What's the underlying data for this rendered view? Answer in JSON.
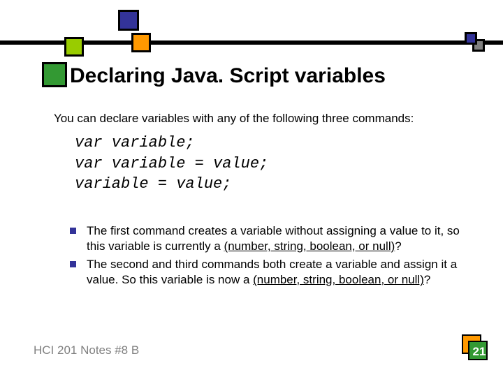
{
  "title": "Declaring Java. Script variables",
  "intro": "You can declare variables with any of the following three commands:",
  "code": {
    "line1": "var variable;",
    "line2": "var variable = value;",
    "line3": "variable = value;"
  },
  "bullets": [
    {
      "pre": "The first command creates a variable without assigning a value to it, so this variable is currently a ",
      "underline": "(number, string, boolean, or null)",
      "post": "?"
    },
    {
      "pre": "The second and third commands both create a variable and assign it a value. So this variable is now a ",
      "underline": "(number, string, boolean, or null)",
      "post": "?"
    }
  ],
  "footer": "HCI 201 Notes #8 B",
  "page_number": "21"
}
